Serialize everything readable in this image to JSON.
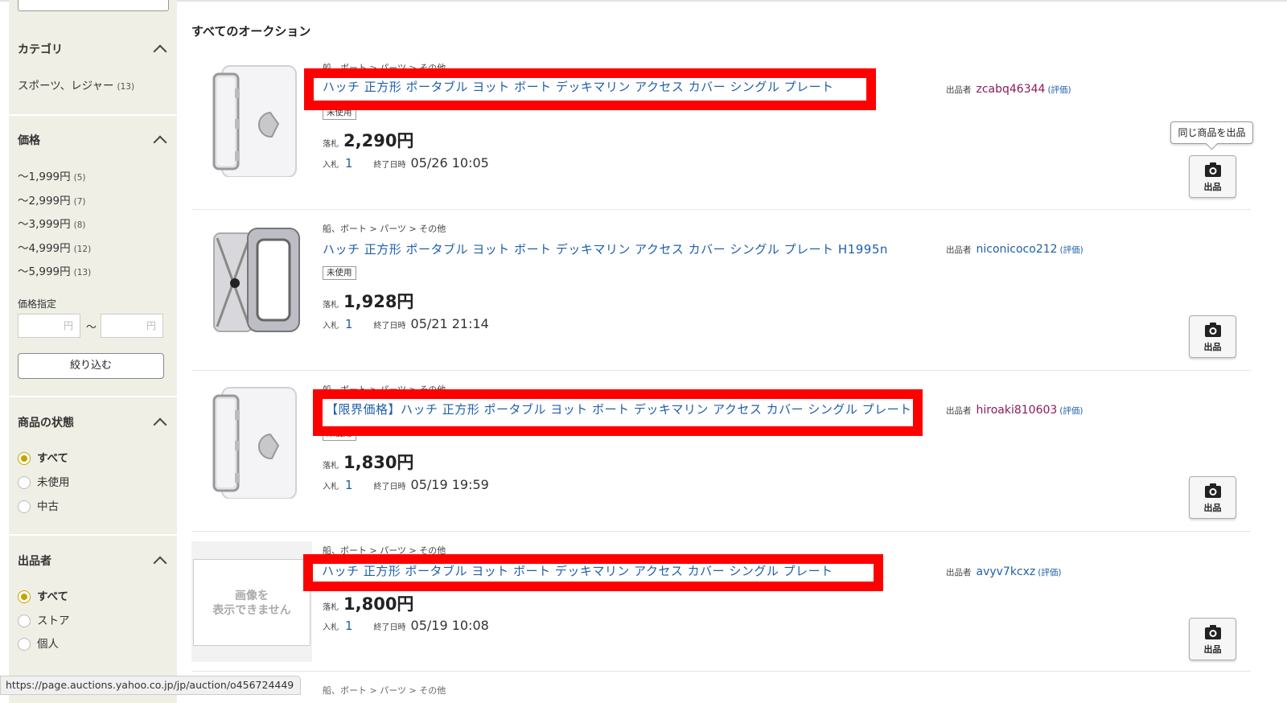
{
  "sidebar": {
    "category": {
      "heading": "カテゴリ",
      "items": [
        {
          "label": "スポーツ、レジャー",
          "count": "(13)"
        }
      ]
    },
    "price": {
      "heading": "価格",
      "items": [
        {
          "label": "～1,999円",
          "count": "(5)"
        },
        {
          "label": "～2,999円",
          "count": "(7)"
        },
        {
          "label": "～3,999円",
          "count": "(8)"
        },
        {
          "label": "～4,999円",
          "count": "(12)"
        },
        {
          "label": "～5,999円",
          "count": "(13)"
        }
      ],
      "range_label": "価格指定",
      "min_placeholder": "円",
      "tilde": "～",
      "max_placeholder": "円",
      "filter_button": "絞り込む"
    },
    "condition": {
      "heading": "商品の状態",
      "options": [
        "すべて",
        "未使用",
        "中古"
      ],
      "selected": "すべて"
    },
    "seller": {
      "heading": "出品者",
      "options": [
        "すべて",
        "ストア",
        "個人"
      ],
      "selected": "すべて"
    }
  },
  "main": {
    "title": "すべてのオークション",
    "tooltip": "同じ商品を出品",
    "items": [
      {
        "breadcrumb": "船、ボート > パーツ > その他",
        "title": "ハッチ 正方形 ポータブル ヨット ボート デッキマリン アクセス カバー シングル プレート",
        "condition": "未使用",
        "price_label": "落札",
        "price": "2,290円",
        "bids_label": "入札",
        "bids": "1",
        "end_label": "終了日時",
        "end": "05/26 10:05",
        "seller_label": "出品者",
        "seller": "zcabq46344",
        "rating": "(評価)",
        "sell_button": "出品"
      },
      {
        "breadcrumb": "船、ボート > パーツ > その他",
        "title": "ハッチ 正方形 ポータブル ヨット ボート デッキマリン アクセス カバー シングル プレート H1995n",
        "condition": "未使用",
        "price_label": "落札",
        "price": "1,928円",
        "bids_label": "入札",
        "bids": "1",
        "end_label": "終了日時",
        "end": "05/21 21:14",
        "seller_label": "出品者",
        "seller": "niconicoco212",
        "rating": "(評価)",
        "sell_button": "出品"
      },
      {
        "breadcrumb": "船、ボート > パーツ > その他",
        "title": "【限界価格】ハッチ 正方形 ポータブル ヨット ボート デッキマリン アクセス カバー シングル プレート",
        "condition": "未使用",
        "price_label": "落札",
        "price": "1,830円",
        "bids_label": "入札",
        "bids": "1",
        "end_label": "終了日時",
        "end": "05/19 19:59",
        "seller_label": "出品者",
        "seller": "hiroaki810603",
        "rating": "(評価)",
        "sell_button": "出品"
      },
      {
        "breadcrumb": "船、ボート > パーツ > その他",
        "title": "ハッチ 正方形 ポータブル ヨット ボート デッキマリン アクセス カバー シングル プレート",
        "no_image": "画像を\n表示できません",
        "price_label": "落札",
        "price": "1,800円",
        "bids_label": "入札",
        "bids": "1",
        "end_label": "終了日時",
        "end": "05/19 10:08",
        "seller_label": "出品者",
        "seller": "avyv7kcxz",
        "rating": "(評価)",
        "sell_button": "出品"
      }
    ],
    "next_breadcrumb": "船、ボート > パーツ > その他"
  },
  "statusbar": {
    "url": "https://page.auctions.yahoo.co.jp/jp/auction/o456724449"
  },
  "colors": {
    "highlight": "#ff0000",
    "link": "#1f5fa8",
    "seller": "#8b1b5a",
    "radio_selected": "#c8a200",
    "sidebar_bg": "#efefe6"
  }
}
